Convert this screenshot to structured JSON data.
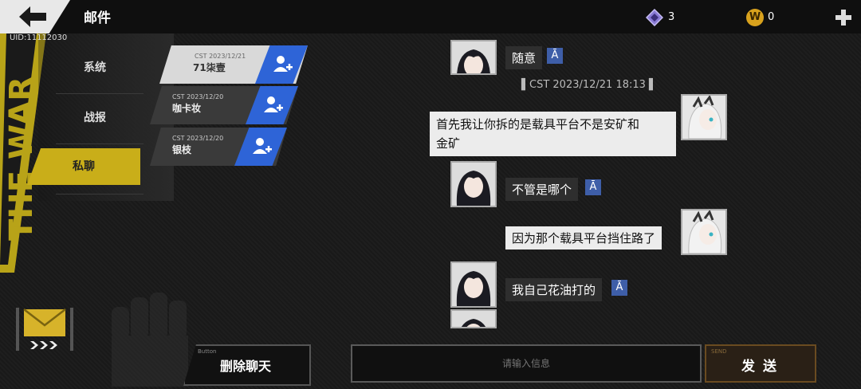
{
  "header": {
    "title": "邮件",
    "uid": "UID:11112030"
  },
  "resources": [
    {
      "name": "diamond-currency",
      "value": "3",
      "color": "#8a7bd6"
    },
    {
      "name": "gold-coin-currency",
      "value": "0",
      "glyph": "W",
      "color": "#d9a21d"
    }
  ],
  "categories": [
    {
      "label": "系统"
    },
    {
      "label": "战报"
    },
    {
      "label": "私聊",
      "selected": true
    }
  ],
  "mails": [
    {
      "date": "CST 2023/12/21",
      "name": "71柒壹",
      "selected": true
    },
    {
      "date": "CST 2023/12/20",
      "name": "咖卡妆"
    },
    {
      "date": "CST 2023/12/20",
      "name": "银枝"
    }
  ],
  "chat": {
    "timestamp": "▌CST 2023/12/21 18:13 ▌",
    "messages": [
      {
        "side": "left",
        "text": "随意"
      },
      {
        "side": "right",
        "text": "首先我让你拆的是载具平台不是安矿和"
      },
      {
        "side": "right",
        "text": "金矿"
      },
      {
        "side": "left",
        "text": "不管是哪个"
      },
      {
        "side": "right",
        "text": "因为那个载具平台挡住路了"
      },
      {
        "side": "left",
        "text": "我自己花油打的"
      }
    ],
    "translate_glyph": "Ā"
  },
  "footer": {
    "delete_caption": "Button",
    "delete_label": "删除聊天",
    "input_placeholder": "请输入信息",
    "send_caption": "SEND",
    "send_label": "发送"
  },
  "colors": {
    "accent_yellow": "#c9ae19",
    "add_friend_blue": "#2e64d7"
  }
}
